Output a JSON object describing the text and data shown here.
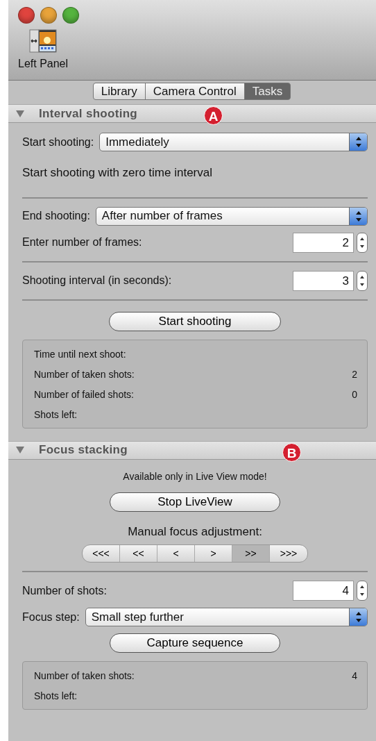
{
  "window": {
    "buttons": [
      {
        "color": "#e0443e"
      },
      {
        "color": "#e8a33a"
      },
      {
        "color": "#55b43f"
      }
    ]
  },
  "toolbar": {
    "label": "Left Panel"
  },
  "tabs": [
    {
      "label": "Library",
      "selected": false
    },
    {
      "label": "Camera Control",
      "selected": false
    },
    {
      "label": "Tasks",
      "selected": true
    }
  ],
  "sections": [
    {
      "title": "Interval shooting",
      "expanded": true,
      "marker": "A",
      "items": [
        {
          "kind": "popup",
          "label": "Start shooting:",
          "value": "Immediately"
        },
        {
          "kind": "note",
          "text": "Start shooting with zero time interval"
        },
        {
          "kind": "divider"
        },
        {
          "kind": "popup",
          "label": "End shooting:",
          "value": "After number of frames"
        },
        {
          "kind": "stepper",
          "label": "Enter number of frames:",
          "value": "2"
        },
        {
          "kind": "divider"
        },
        {
          "kind": "stepper",
          "label": "Shooting interval (in seconds):",
          "value": "3"
        },
        {
          "kind": "divider"
        },
        {
          "kind": "button",
          "label": "Start shooting"
        },
        {
          "kind": "status",
          "rows": [
            {
              "label": "Time until next shoot:"
            },
            {
              "label": "Number of taken shots:",
              "value": "2"
            },
            {
              "label": "Number of failed shots:",
              "value": "0"
            },
            {
              "label": "Shots left:"
            }
          ]
        }
      ]
    },
    {
      "title": "Focus stacking",
      "expanded": true,
      "marker": "B",
      "items": [
        {
          "kind": "caption",
          "text": "Available only in Live View mode!"
        },
        {
          "kind": "button",
          "label": "Stop LiveView"
        },
        {
          "kind": "heading",
          "text": "Manual focus adjustment:"
        },
        {
          "kind": "segmented",
          "segments": [
            {
              "label": "<<<",
              "selected": false
            },
            {
              "label": "<<",
              "selected": false
            },
            {
              "label": "<",
              "selected": false
            },
            {
              "label": ">",
              "selected": false
            },
            {
              "label": ">>",
              "selected": true
            },
            {
              "label": ">>>",
              "selected": false
            }
          ]
        },
        {
          "kind": "divider"
        },
        {
          "kind": "stepper",
          "label": "Number of shots:",
          "value": "4"
        },
        {
          "kind": "popup",
          "label": "Focus step:",
          "value": "Small step further"
        },
        {
          "kind": "button",
          "label": "Capture sequence"
        },
        {
          "kind": "status",
          "rows": [
            {
              "label": "Number of taken shots:",
              "value": "4"
            },
            {
              "label": "Shots left:"
            }
          ]
        }
      ]
    }
  ]
}
